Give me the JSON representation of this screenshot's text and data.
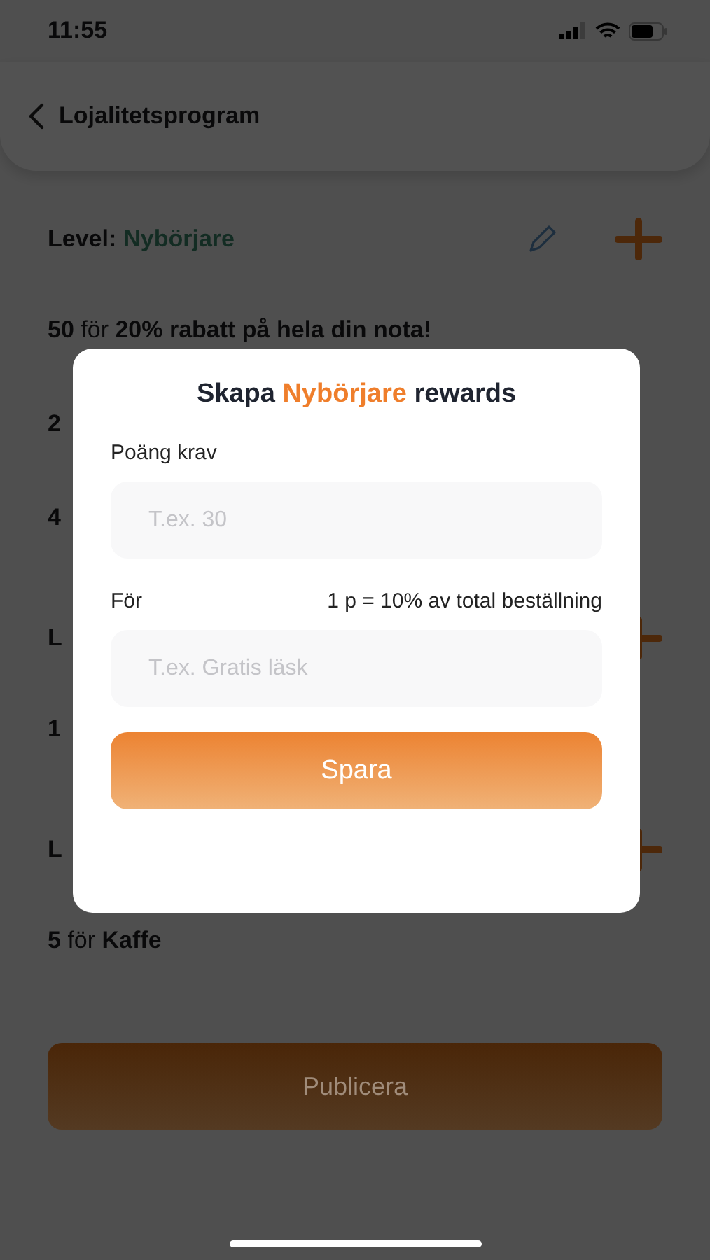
{
  "status_bar": {
    "time": "11:55"
  },
  "header": {
    "title": "Lojalitetsprogram"
  },
  "rows": [
    {
      "kind": "level",
      "prefix": "Level:",
      "name": "Nybörjare",
      "edit_icon": true
    },
    {
      "kind": "reward",
      "text": "**50** för **20% rabatt på hela din nota!**"
    },
    {
      "kind": "reward",
      "text": "**2**"
    },
    {
      "kind": "reward",
      "text": "**4**"
    },
    {
      "kind": "level",
      "prefix": "L",
      "edit_icon": false
    },
    {
      "kind": "reward",
      "text": "**1**"
    },
    {
      "kind": "level",
      "prefix": "L",
      "edit_icon": false
    },
    {
      "kind": "reward",
      "text": "**5** för **Kaffe**"
    }
  ],
  "publish_button": {
    "label": "Publicera"
  },
  "dialog": {
    "title_before": "Skapa",
    "title_highlight": "Nybörjare",
    "title_after": "rewards",
    "fields": [
      {
        "label": "Poäng krav",
        "placeholder": "T.ex. 30"
      },
      {
        "label": "För",
        "hint": "1 p = 10% av total beställning",
        "placeholder": "T.ex. Gratis läsk"
      }
    ],
    "save_button": {
      "label": "Spara"
    }
  }
}
